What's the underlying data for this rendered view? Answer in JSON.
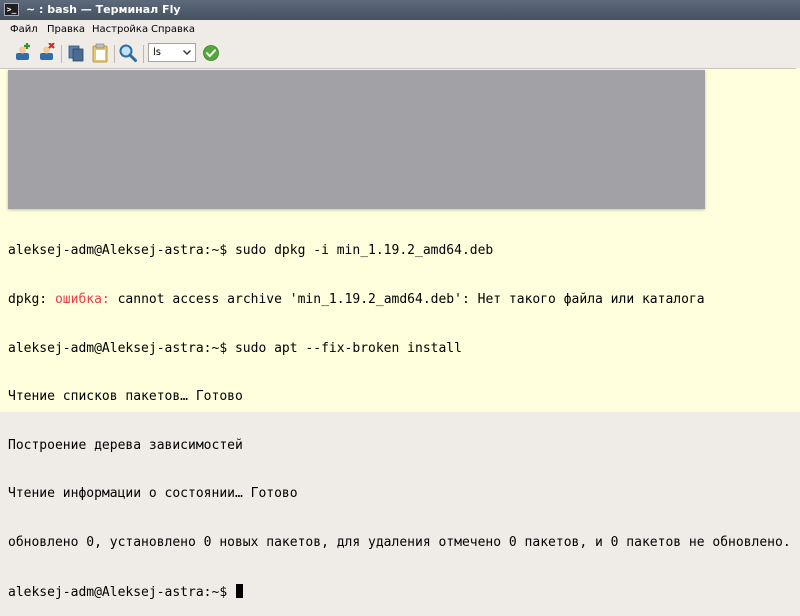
{
  "window": {
    "title": "~ : bash — Терминал Fly",
    "icon": "terminal-icon"
  },
  "menu": {
    "items": [
      "Файл",
      "Правка",
      "Настройка",
      "Справка"
    ]
  },
  "toolbar": {
    "buttons": [
      "new-tab-icon",
      "close-tab-icon",
      "copy-icon",
      "paste-icon",
      "search-icon"
    ],
    "command_combo": {
      "value": "ls",
      "dropdown_icon": "chevron-down-icon"
    },
    "execute_icon": "checkmark-icon"
  },
  "terminal": {
    "background": "#ffffde",
    "error_color": "#e8414c",
    "lines": [
      {
        "text": "aleksej-adm@Aleksej-astra:~$ sudo dpkg -i min_1.19.2_amd64.deb"
      },
      {
        "prefix": "dpkg: ",
        "error": "ошибка:",
        "rest": " cannot access archive 'min_1.19.2_amd64.deb': Нет такого файла или каталога"
      },
      {
        "text": "aleksej-adm@Aleksej-astra:~$ sudo apt --fix-broken install"
      },
      {
        "text": "Чтение списков пакетов… Готово"
      },
      {
        "text": "Построение дерева зависимостей"
      },
      {
        "text": "Чтение информации о состоянии… Готово"
      },
      {
        "text": "обновлено 0, установлено 0 новых пакетов, для удаления отмечено 0 пакетов, и 0 пакетов не обновлено."
      },
      {
        "text": "aleksej-adm@Aleksej-astra:~$ "
      }
    ]
  }
}
